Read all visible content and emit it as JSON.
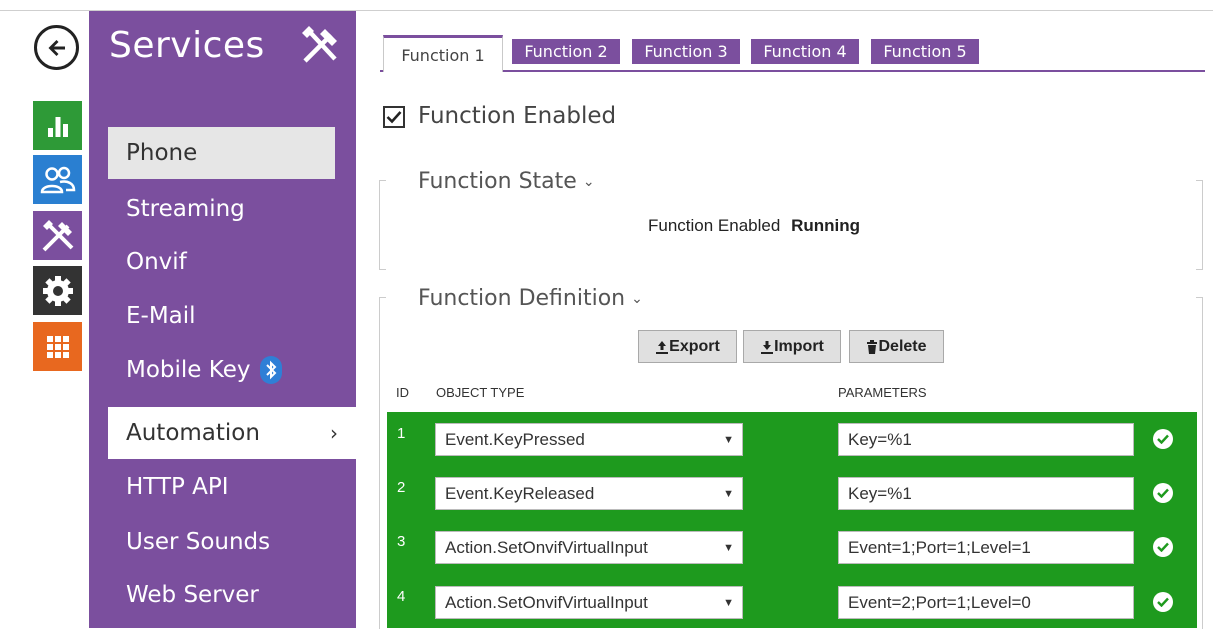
{
  "sidebar": {
    "title": "Services",
    "items": [
      {
        "label": "Phone"
      },
      {
        "label": "Streaming"
      },
      {
        "label": "Onvif"
      },
      {
        "label": "E-Mail"
      },
      {
        "label": "Mobile Key"
      },
      {
        "label": "Automation"
      },
      {
        "label": "HTTP API"
      },
      {
        "label": "User Sounds"
      },
      {
        "label": "Web Server"
      }
    ],
    "active_chevron": "›"
  },
  "rail": {
    "icons": [
      "back-arrow-icon",
      "chart-icon",
      "users-icon",
      "tools-icon",
      "gear-icon",
      "grid-icon"
    ],
    "colors": {
      "chart": "#2e9a37",
      "users": "#2a7fd1",
      "tools": "#7b4f9e",
      "gear": "#333333",
      "grid": "#e8681f"
    }
  },
  "tabs": [
    {
      "label": "Function 1"
    },
    {
      "label": "Function 2"
    },
    {
      "label": "Function 3"
    },
    {
      "label": "Function 4"
    },
    {
      "label": "Function 5"
    }
  ],
  "function_enabled": {
    "label": "Function Enabled",
    "checked": true
  },
  "state_section": {
    "title": "Function State",
    "caret": "⌄",
    "state_label": "Function Enabled",
    "state_value": "Running"
  },
  "definition_section": {
    "title": "Function Definition",
    "caret": "⌄",
    "buttons": {
      "export": "Export",
      "import": "Import",
      "delete": "Delete"
    },
    "columns": {
      "id": "ID",
      "object_type": "OBJECT TYPE",
      "parameters": "PARAMETERS"
    },
    "rows": [
      {
        "id": "1",
        "object_type": "Event.KeyPressed",
        "parameters": "Key=%1"
      },
      {
        "id": "2",
        "object_type": "Event.KeyReleased",
        "parameters": "Key=%1"
      },
      {
        "id": "3",
        "object_type": "Action.SetOnvifVirtualInput",
        "parameters": "Event=1;Port=1;Level=1"
      },
      {
        "id": "4",
        "object_type": "Action.SetOnvifVirtualInput",
        "parameters": "Event=2;Port=1;Level=0"
      }
    ]
  },
  "colors": {
    "accent": "#7b4f9e",
    "table_green": "#1e9a1e",
    "status_ok": "#1e9a1e"
  }
}
